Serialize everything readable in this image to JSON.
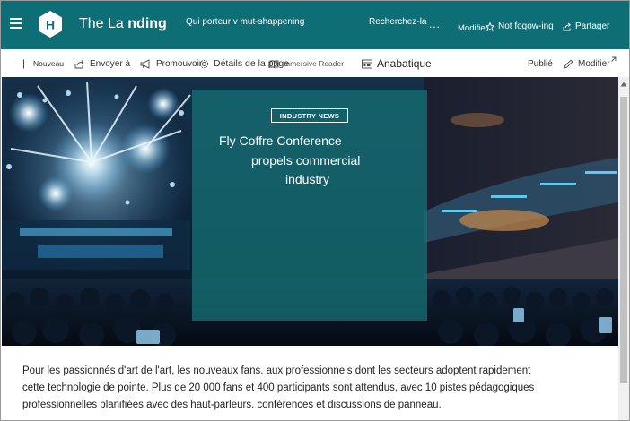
{
  "header": {
    "logo_letter": "H",
    "title_part1": "The La",
    "title_part2": "nding",
    "nav_item_1": "Qui porteur v mut-shappening",
    "nav_item_2": "Recherchez-la",
    "nav_more": "...",
    "edit_label": "Modifier",
    "follow_label": "Not fogow-ing",
    "share_label": "Partager",
    "bg_color": "#0d6e76"
  },
  "commandbar": {
    "new_label": "Nouveau",
    "send_label": "Envoyer à",
    "promote_label": "Promouvoir",
    "details_label": "Détails de la page",
    "reader_label": "mmersive Reader",
    "analytics_label": "Anabatique",
    "published_label": "Publié",
    "edit_label": "Modifier"
  },
  "hero": {
    "tag": "INDUSTRY NEWS",
    "headline_line1": "Fly Coffre Conference",
    "headline_line2": "propels commercial",
    "headline_line3": "industry",
    "card_color": "#146e73"
  },
  "body": {
    "line1": "Pour les passionnés d'art de l'art, les nouveaux fans. aux professionnels dont les secteurs adoptent rapidement",
    "line2": "cette technologie de pointe. Plus de 20 000 fans et 400 participants sont attendus, avec 10 pistes pédagogiques",
    "line3": "professionnelles planifiées avec des haut-parleurs. conférences et discussions de panneau."
  }
}
